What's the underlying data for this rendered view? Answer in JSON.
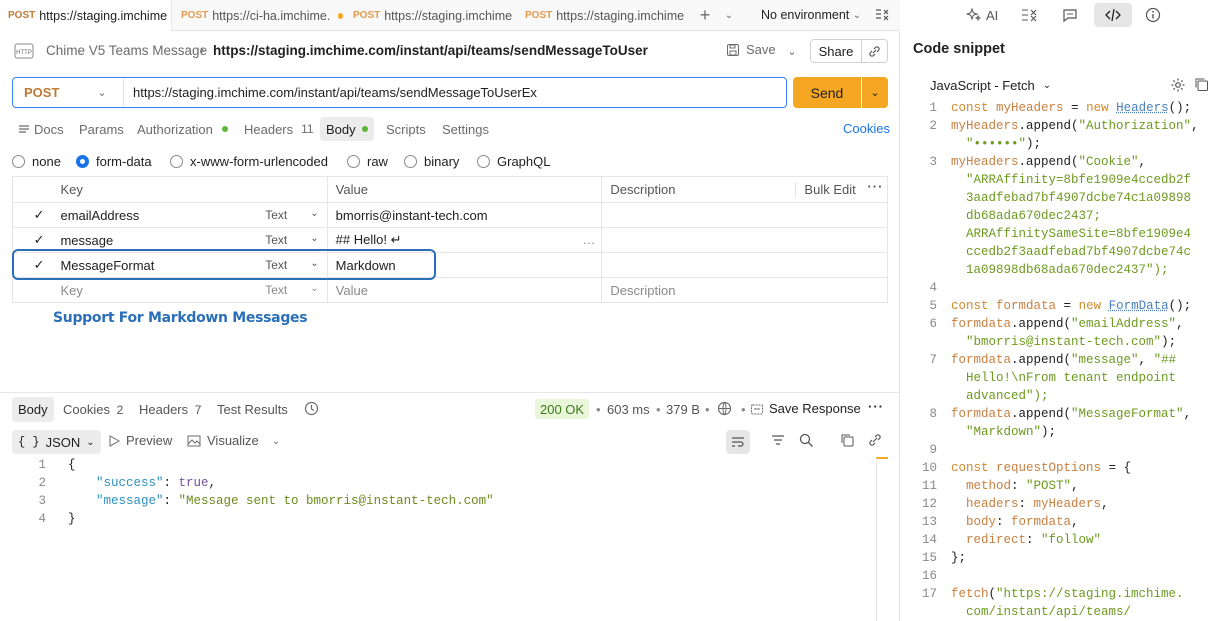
{
  "tabs": [
    {
      "method": "POST",
      "title": "https://staging.imchime",
      "active": true
    },
    {
      "method": "POST",
      "title": "https://ci-ha.imchime.",
      "dirty": true
    },
    {
      "method": "POST",
      "title": "https://staging.imchime"
    },
    {
      "method": "POST",
      "title": "https://staging.imchime"
    }
  ],
  "environment": "No environment",
  "breadcrumb": {
    "collection": "Chime V5 Teams Message",
    "request": "https://staging.imchime.com/instant/api/teams/sendMessageToUser"
  },
  "actions": {
    "save": "Save",
    "share": "Share"
  },
  "request": {
    "method": "POST",
    "url": "https://staging.imchime.com/instant/api/teams/sendMessageToUserEx",
    "send": "Send"
  },
  "subtabs": {
    "docs": "Docs",
    "params": "Params",
    "authorization": "Authorization",
    "headers": "Headers",
    "headers_count": "11",
    "body": "Body",
    "scripts": "Scripts",
    "settings": "Settings",
    "cookies": "Cookies"
  },
  "body_types": [
    "none",
    "form-data",
    "x-www-form-urlencoded",
    "raw",
    "binary",
    "GraphQL"
  ],
  "table": {
    "headers": {
      "key": "Key",
      "value": "Value",
      "description": "Description",
      "bulk": "Bulk Edit"
    },
    "rows": [
      {
        "key": "emailAddress",
        "type": "Text",
        "value": "bmorris@instant-tech.com"
      },
      {
        "key": "message",
        "type": "Text",
        "value": "## Hello! ↵"
      },
      {
        "key": "MessageFormat",
        "type": "Text",
        "value": "Markdown"
      }
    ],
    "placeholder": {
      "key": "Key",
      "type": "Text",
      "value": "Value",
      "description": "Description"
    }
  },
  "annotation": "Support For Markdown Messages",
  "response": {
    "tabs": {
      "body": "Body",
      "cookies": "Cookies",
      "cookies_count": "2",
      "headers": "Headers",
      "headers_count": "7",
      "tests": "Test Results"
    },
    "status": "200 OK",
    "time": "603 ms",
    "size": "379 B",
    "save": "Save Response",
    "format": "JSON",
    "preview": "Preview",
    "visualize": "Visualize",
    "lines": [
      {
        "n": "1",
        "text": "{"
      },
      {
        "n": "2",
        "k": "\"success\"",
        "v": "true",
        "vt": "bool",
        "comma": ","
      },
      {
        "n": "3",
        "k": "\"message\"",
        "v": "\"Message sent to bmorris@instant-tech.com\"",
        "vt": "str",
        "comma": ""
      },
      {
        "n": "4",
        "text": "}"
      }
    ]
  },
  "snippet": {
    "ai": "AI",
    "title": "Code snippet",
    "language": "JavaScript - Fetch",
    "lines": [
      {
        "n": "1",
        "t": "const myHeaders = new Headers();"
      },
      {
        "n": "2",
        "t": "myHeaders.append(\"Authorization\","
      },
      {
        "n": "",
        "t": "  \"••••••\");"
      },
      {
        "n": "3",
        "t": "myHeaders.append(\"Cookie\","
      },
      {
        "n": "",
        "t": "  \"ARRAffinity=8bfe1909e4ccedb2f"
      },
      {
        "n": "",
        "t": "  3aadfebad7bf4907dcbe74c1a09898"
      },
      {
        "n": "",
        "t": "  db68ada670dec2437;"
      },
      {
        "n": "",
        "t": "  ARRAffinitySameSite=8bfe1909e4"
      },
      {
        "n": "",
        "t": "  ccedb2f3aadfebad7bf4907dcbe74c"
      },
      {
        "n": "",
        "t": "  1a09898db68ada670dec2437\");"
      },
      {
        "n": "4",
        "t": ""
      },
      {
        "n": "5",
        "t": "const formdata = new FormData();"
      },
      {
        "n": "6",
        "t": "formdata.append(\"emailAddress\","
      },
      {
        "n": "",
        "t": "  \"bmorris@instant-tech.com\");"
      },
      {
        "n": "7",
        "t": "formdata.append(\"message\", \"##"
      },
      {
        "n": "",
        "t": "  Hello!\\nFrom tenant endpoint"
      },
      {
        "n": "",
        "t": "  advanced\");"
      },
      {
        "n": "8",
        "t": "formdata.append(\"MessageFormat\","
      },
      {
        "n": "",
        "t": "  \"Markdown\");"
      },
      {
        "n": "9",
        "t": ""
      },
      {
        "n": "10",
        "t": "const requestOptions = {"
      },
      {
        "n": "11",
        "t": "  method: \"POST\","
      },
      {
        "n": "12",
        "t": "  headers: myHeaders,"
      },
      {
        "n": "13",
        "t": "  body: formdata,"
      },
      {
        "n": "14",
        "t": "  redirect: \"follow\""
      },
      {
        "n": "15",
        "t": "};"
      },
      {
        "n": "16",
        "t": ""
      },
      {
        "n": "17",
        "t": "fetch(\"https://staging.imchime."
      },
      {
        "n": "",
        "t": "  com/instant/api/teams/"
      }
    ]
  }
}
